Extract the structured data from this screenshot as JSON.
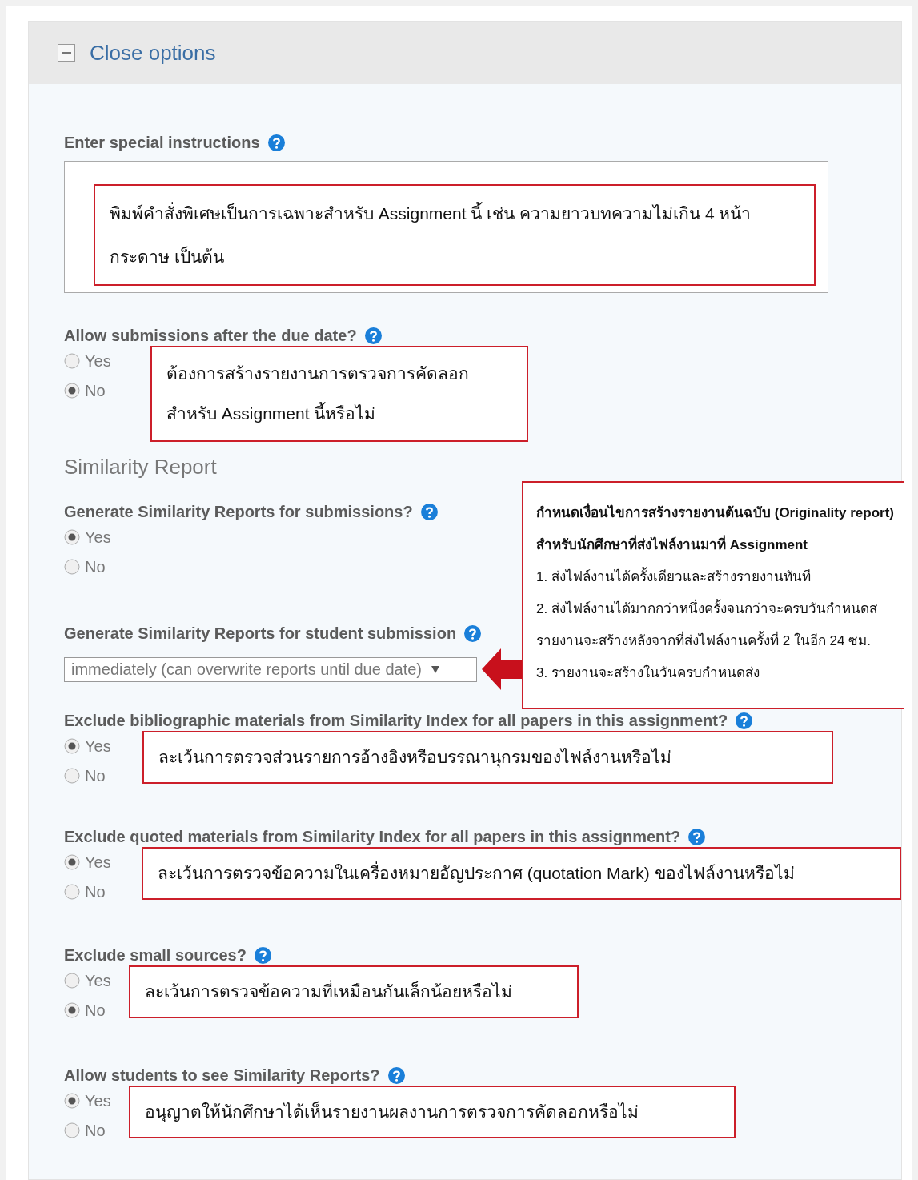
{
  "panel": {
    "title": "Close options",
    "expanded": true
  },
  "fields": [
    {
      "kind": "textarea",
      "label": "Enter special instructions",
      "note": "พิมพ์คำสั่งพิเศษเป็นการเฉพาะสำหรับ Assignment นี้ เช่น ความยาวบทความไม่เกิน 4 หน้ากระดาษ เป็นต้น"
    },
    {
      "kind": "radio",
      "label": "Allow submissions after the due date?",
      "options": [
        {
          "label": "Yes",
          "selected": false
        },
        {
          "label": "No",
          "selected": true
        }
      ],
      "note": "ต้องการสร้างรายงานการตรวจการคัดลอก สำหรับ Assignment นี้หรือไม่"
    },
    {
      "kind": "heading",
      "label": "Similarity Report"
    },
    {
      "kind": "radio",
      "label": "Generate Similarity Reports for submissions?",
      "options": [
        {
          "label": "Yes",
          "selected": true
        },
        {
          "label": "No",
          "selected": false
        }
      ]
    },
    {
      "kind": "select",
      "label": "Generate Similarity Reports for student submission",
      "value": "immediately (can overwrite reports until due date)",
      "callout": {
        "title": "กำหนดเงื่อนไขการสร้างรายงานต้นฉบับ (Originality report) สำหรับนักศึกษาที่ส่งไฟล์งานมาที่ Assignment",
        "lines": [
          "1. ส่งไฟล์งานได้ครั้งเดียวและสร้างรายงานทันที",
          "2. ส่งไฟล์งานได้มากกว่าหนึ่งครั้งจนกว่าจะครบวันกำหนดส",
          "รายงานจะสร้างหลังจากที่ส่งไฟล์งานครั้งที่ 2 ในอีก 24 ซม.",
          "3. รายงานจะสร้างในวันครบกำหนดส่ง"
        ]
      }
    },
    {
      "kind": "radio",
      "label": "Exclude bibliographic materials from Similarity Index for all papers in this assignment?",
      "options": [
        {
          "label": "Yes",
          "selected": true
        },
        {
          "label": "No",
          "selected": false
        }
      ],
      "note": "ละเว้นการตรวจส่วนรายการอ้างอิงหรือบรรณานุกรมของไฟล์งานหรือไม่"
    },
    {
      "kind": "radio",
      "label": "Exclude quoted materials from Similarity Index for all papers in this assignment?",
      "options": [
        {
          "label": "Yes",
          "selected": true
        },
        {
          "label": "No",
          "selected": false
        }
      ],
      "note": "ละเว้นการตรวจข้อความในเครื่องหมายอัญประกาศ (quotation Mark) ของไฟล์งานหรือไม่"
    },
    {
      "kind": "radio",
      "label": "Exclude small sources?",
      "options": [
        {
          "label": "Yes",
          "selected": false
        },
        {
          "label": "No",
          "selected": true
        }
      ],
      "note": "ละเว้นการตรวจข้อความที่เหมือนกันเล็กน้อยหรือไม่"
    },
    {
      "kind": "radio",
      "label": "Allow students to see Similarity Reports?",
      "options": [
        {
          "label": "Yes",
          "selected": true
        },
        {
          "label": "No",
          "selected": false
        }
      ],
      "note": "อนุญาตให้นักศึกษาได้เห็นรายงานผลงานการตรวจการคัดลอกหรือไม่"
    }
  ]
}
